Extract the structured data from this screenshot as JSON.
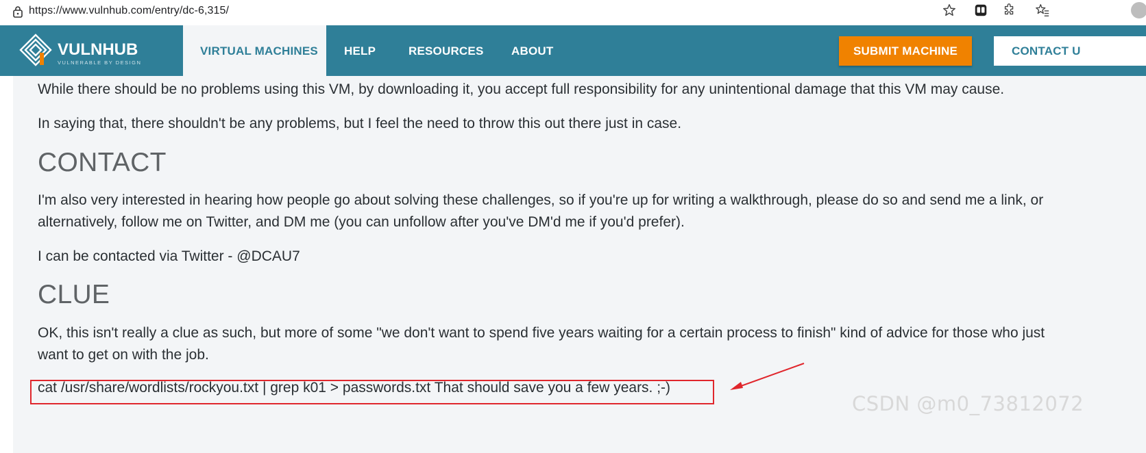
{
  "browser": {
    "url": "https://www.vulnhub.com/entry/dc-6,315/",
    "icons": [
      "lock-icon",
      "star-icon",
      "extension-icon",
      "favorites-icon",
      "profile-icon"
    ]
  },
  "nav": {
    "logo_text": "VULNHUB",
    "logo_tagline": "VULNERABLE BY DESIGN",
    "items": [
      {
        "label": "VIRTUAL MACHINES",
        "active": true
      },
      {
        "label": "HELP"
      },
      {
        "label": "RESOURCES"
      },
      {
        "label": "ABOUT"
      }
    ],
    "submit_label": "SUBMIT MACHINE",
    "contact_label": "CONTACT U",
    "colors": {
      "bar": "#2f7f98",
      "submit": "#f08200"
    }
  },
  "content": {
    "disclaimer_1": "While there should be no problems using this VM, by downloading it, you accept full responsibility for any unintentional damage that this VM may cause.",
    "disclaimer_2": "In saying that, there shouldn't be any problems, but I feel the need to throw this out there just in case.",
    "contact_heading": "CONTACT",
    "contact_text": "I'm also very interested in hearing how people go about solving these challenges, so if you're up for writing a walkthrough, please do so and send me a link, or alternatively, follow me on Twitter, and DM me (you can unfollow after you've DM'd me if you'd prefer).",
    "contact_twitter": "I can be contacted via Twitter - @DCAU7",
    "clue_heading": "CLUE",
    "clue_text": "OK, this isn't really a clue as such, but more of some \"we don't want to spend five years waiting for a certain process to finish\" kind of advice for those who just want to get on with the job.",
    "clue_command": "cat /usr/share/wordlists/rockyou.txt | grep k01 > passwords.txt That should save you a few years. ;-)"
  },
  "annotation": {
    "color": "#e0262c"
  },
  "watermark": "CSDN @m0_73812072"
}
